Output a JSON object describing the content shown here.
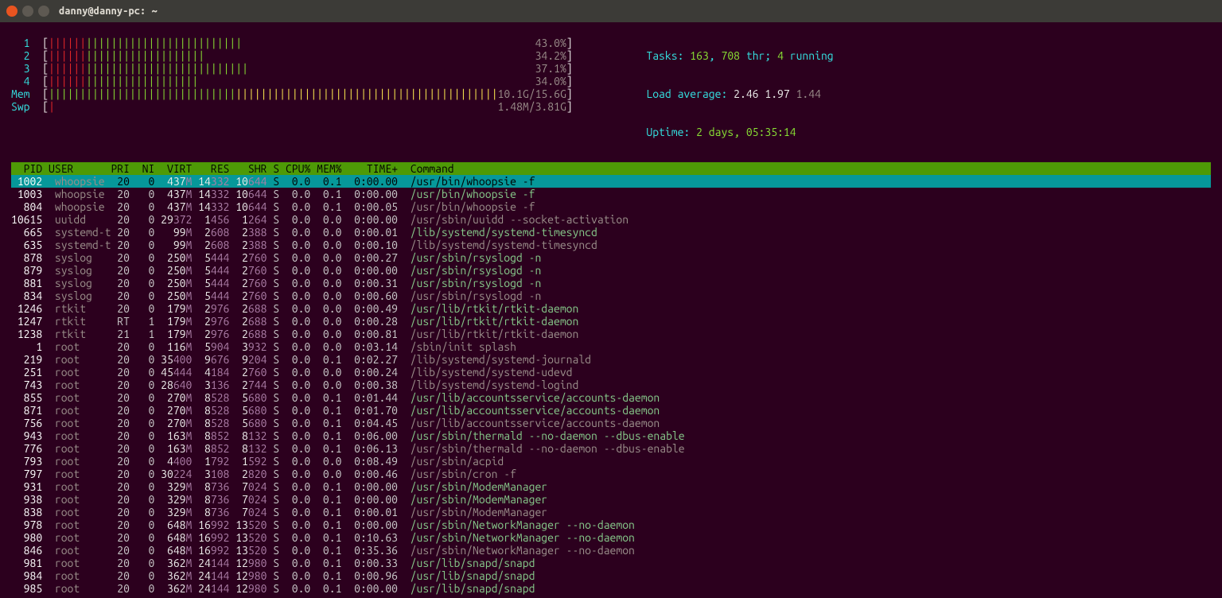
{
  "window": {
    "title": "danny@danny-pc: ~"
  },
  "meters": {
    "cpu": [
      {
        "label": "1",
        "bars": "|||||||||||||||||||||||||||||||",
        "percent": "43.0%"
      },
      {
        "label": "2",
        "bars": "|||||||||||||||||||||||||",
        "percent": "34.2%"
      },
      {
        "label": "3",
        "bars": "||||||||||||||||||||||||||||||||",
        "percent": "37.1%"
      },
      {
        "label": "4",
        "bars": "||||||||||||||||||||||||",
        "percent": "34.0%"
      }
    ],
    "mem": {
      "label": "Mem",
      "used": "10.1G",
      "total": "15.6G"
    },
    "swp": {
      "label": "Swp",
      "used": "1.48M",
      "total": "3.81G"
    }
  },
  "summary": {
    "tasks_label": "Tasks: ",
    "tasks": "163",
    "thr": "708",
    "thr_label": " thr; ",
    "running": "4",
    "running_label": " running",
    "load_label": "Load average: ",
    "load1": "2.46",
    "load2": "1.97",
    "load3": "1.44",
    "uptime_label": "Uptime: ",
    "uptime": "2 days, 05:35:14"
  },
  "columns": [
    "PID",
    "USER",
    "PRI",
    "NI",
    "VIRT",
    "RES",
    "SHR",
    "S",
    "CPU%",
    "MEM%",
    "TIME+",
    "Command"
  ],
  "processes": [
    {
      "pid": "1002",
      "user": "whoopsie",
      "pri": "20",
      "ni": "0",
      "virt": "437M",
      "res": "14332",
      "shr": "10644",
      "s": "S",
      "cpu": "0.0",
      "mem": "0.1",
      "time": "0:00.00",
      "cmd": "/usr/bin/whoopsie -f",
      "sel": true,
      "hl": true
    },
    {
      "pid": "1003",
      "user": "whoopsie",
      "pri": "20",
      "ni": "0",
      "virt": "437M",
      "res": "14332",
      "shr": "10644",
      "s": "S",
      "cpu": "0.0",
      "mem": "0.1",
      "time": "0:00.00",
      "cmd": "/usr/bin/whoopsie -f",
      "hl": true
    },
    {
      "pid": "804",
      "user": "whoopsie",
      "pri": "20",
      "ni": "0",
      "virt": "437M",
      "res": "14332",
      "shr": "10644",
      "s": "S",
      "cpu": "0.0",
      "mem": "0.1",
      "time": "0:00.05",
      "cmd": "/usr/bin/whoopsie -f"
    },
    {
      "pid": "10615",
      "user": "uuidd",
      "pri": "20",
      "ni": "0",
      "virt": "29372",
      "res": "1456",
      "shr": "1264",
      "s": "S",
      "cpu": "0.0",
      "mem": "0.0",
      "time": "0:00.00",
      "cmd": "/usr/sbin/uuidd --socket-activation"
    },
    {
      "pid": "665",
      "user": "systemd-t",
      "pri": "20",
      "ni": "0",
      "virt": "99M",
      "res": "2608",
      "shr": "2388",
      "s": "S",
      "cpu": "0.0",
      "mem": "0.0",
      "time": "0:00.01",
      "cmd": "/lib/systemd/systemd-timesyncd",
      "hl": true
    },
    {
      "pid": "635",
      "user": "systemd-t",
      "pri": "20",
      "ni": "0",
      "virt": "99M",
      "res": "2608",
      "shr": "2388",
      "s": "S",
      "cpu": "0.0",
      "mem": "0.0",
      "time": "0:00.10",
      "cmd": "/lib/systemd/systemd-timesyncd"
    },
    {
      "pid": "878",
      "user": "syslog",
      "pri": "20",
      "ni": "0",
      "virt": "250M",
      "res": "5444",
      "shr": "2760",
      "s": "S",
      "cpu": "0.0",
      "mem": "0.0",
      "time": "0:00.27",
      "cmd": "/usr/sbin/rsyslogd -n",
      "hl": true
    },
    {
      "pid": "879",
      "user": "syslog",
      "pri": "20",
      "ni": "0",
      "virt": "250M",
      "res": "5444",
      "shr": "2760",
      "s": "S",
      "cpu": "0.0",
      "mem": "0.0",
      "time": "0:00.00",
      "cmd": "/usr/sbin/rsyslogd -n",
      "hl": true
    },
    {
      "pid": "881",
      "user": "syslog",
      "pri": "20",
      "ni": "0",
      "virt": "250M",
      "res": "5444",
      "shr": "2760",
      "s": "S",
      "cpu": "0.0",
      "mem": "0.0",
      "time": "0:00.31",
      "cmd": "/usr/sbin/rsyslogd -n",
      "hl": true
    },
    {
      "pid": "834",
      "user": "syslog",
      "pri": "20",
      "ni": "0",
      "virt": "250M",
      "res": "5444",
      "shr": "2760",
      "s": "S",
      "cpu": "0.0",
      "mem": "0.0",
      "time": "0:00.60",
      "cmd": "/usr/sbin/rsyslogd -n"
    },
    {
      "pid": "1246",
      "user": "rtkit",
      "pri": "20",
      "ni": "0",
      "virt": "179M",
      "res": "2976",
      "shr": "2688",
      "s": "S",
      "cpu": "0.0",
      "mem": "0.0",
      "time": "0:00.49",
      "cmd": "/usr/lib/rtkit/rtkit-daemon",
      "hl": true
    },
    {
      "pid": "1247",
      "user": "rtkit",
      "pri": "RT",
      "ni": "1",
      "virt": "179M",
      "res": "2976",
      "shr": "2688",
      "s": "S",
      "cpu": "0.0",
      "mem": "0.0",
      "time": "0:00.28",
      "cmd": "/usr/lib/rtkit/rtkit-daemon",
      "hl": true
    },
    {
      "pid": "1238",
      "user": "rtkit",
      "pri": "21",
      "ni": "1",
      "virt": "179M",
      "res": "2976",
      "shr": "2688",
      "s": "S",
      "cpu": "0.0",
      "mem": "0.0",
      "time": "0:00.81",
      "cmd": "/usr/lib/rtkit/rtkit-daemon"
    },
    {
      "pid": "1",
      "user": "root",
      "pri": "20",
      "ni": "0",
      "virt": "116M",
      "res": "5904",
      "shr": "3932",
      "s": "S",
      "cpu": "0.0",
      "mem": "0.0",
      "time": "0:03.14",
      "cmd": "/sbin/init splash"
    },
    {
      "pid": "219",
      "user": "root",
      "pri": "20",
      "ni": "0",
      "virt": "35400",
      "res": "9676",
      "shr": "9204",
      "s": "S",
      "cpu": "0.0",
      "mem": "0.1",
      "time": "0:02.27",
      "cmd": "/lib/systemd/systemd-journald"
    },
    {
      "pid": "251",
      "user": "root",
      "pri": "20",
      "ni": "0",
      "virt": "45444",
      "res": "4184",
      "shr": "2760",
      "s": "S",
      "cpu": "0.0",
      "mem": "0.0",
      "time": "0:00.24",
      "cmd": "/lib/systemd/systemd-udevd"
    },
    {
      "pid": "743",
      "user": "root",
      "pri": "20",
      "ni": "0",
      "virt": "28640",
      "res": "3136",
      "shr": "2744",
      "s": "S",
      "cpu": "0.0",
      "mem": "0.0",
      "time": "0:00.38",
      "cmd": "/lib/systemd/systemd-logind"
    },
    {
      "pid": "855",
      "user": "root",
      "pri": "20",
      "ni": "0",
      "virt": "270M",
      "res": "8528",
      "shr": "5680",
      "s": "S",
      "cpu": "0.0",
      "mem": "0.1",
      "time": "0:01.44",
      "cmd": "/usr/lib/accountsservice/accounts-daemon",
      "hl": true
    },
    {
      "pid": "871",
      "user": "root",
      "pri": "20",
      "ni": "0",
      "virt": "270M",
      "res": "8528",
      "shr": "5680",
      "s": "S",
      "cpu": "0.0",
      "mem": "0.1",
      "time": "0:01.70",
      "cmd": "/usr/lib/accountsservice/accounts-daemon",
      "hl": true
    },
    {
      "pid": "756",
      "user": "root",
      "pri": "20",
      "ni": "0",
      "virt": "270M",
      "res": "8528",
      "shr": "5680",
      "s": "S",
      "cpu": "0.0",
      "mem": "0.1",
      "time": "0:04.45",
      "cmd": "/usr/lib/accountsservice/accounts-daemon"
    },
    {
      "pid": "943",
      "user": "root",
      "pri": "20",
      "ni": "0",
      "virt": "163M",
      "res": "8852",
      "shr": "8132",
      "s": "S",
      "cpu": "0.0",
      "mem": "0.1",
      "time": "0:06.00",
      "cmd": "/usr/sbin/thermald --no-daemon --dbus-enable",
      "hl": true
    },
    {
      "pid": "776",
      "user": "root",
      "pri": "20",
      "ni": "0",
      "virt": "163M",
      "res": "8852",
      "shr": "8132",
      "s": "S",
      "cpu": "0.0",
      "mem": "0.1",
      "time": "0:06.13",
      "cmd": "/usr/sbin/thermald --no-daemon --dbus-enable"
    },
    {
      "pid": "793",
      "user": "root",
      "pri": "20",
      "ni": "0",
      "virt": "4400",
      "res": "1792",
      "shr": "1592",
      "s": "S",
      "cpu": "0.0",
      "mem": "0.0",
      "time": "0:08.49",
      "cmd": "/usr/sbin/acpid"
    },
    {
      "pid": "797",
      "user": "root",
      "pri": "20",
      "ni": "0",
      "virt": "30224",
      "res": "3108",
      "shr": "2820",
      "s": "S",
      "cpu": "0.0",
      "mem": "0.0",
      "time": "0:00.46",
      "cmd": "/usr/sbin/cron -f"
    },
    {
      "pid": "931",
      "user": "root",
      "pri": "20",
      "ni": "0",
      "virt": "329M",
      "res": "8736",
      "shr": "7024",
      "s": "S",
      "cpu": "0.0",
      "mem": "0.1",
      "time": "0:00.00",
      "cmd": "/usr/sbin/ModemManager",
      "hl": true
    },
    {
      "pid": "938",
      "user": "root",
      "pri": "20",
      "ni": "0",
      "virt": "329M",
      "res": "8736",
      "shr": "7024",
      "s": "S",
      "cpu": "0.0",
      "mem": "0.1",
      "time": "0:00.00",
      "cmd": "/usr/sbin/ModemManager",
      "hl": true
    },
    {
      "pid": "838",
      "user": "root",
      "pri": "20",
      "ni": "0",
      "virt": "329M",
      "res": "8736",
      "shr": "7024",
      "s": "S",
      "cpu": "0.0",
      "mem": "0.1",
      "time": "0:00.01",
      "cmd": "/usr/sbin/ModemManager"
    },
    {
      "pid": "978",
      "user": "root",
      "pri": "20",
      "ni": "0",
      "virt": "648M",
      "res": "16992",
      "shr": "13520",
      "s": "S",
      "cpu": "0.0",
      "mem": "0.1",
      "time": "0:00.00",
      "cmd": "/usr/sbin/NetworkManager --no-daemon",
      "hl": true
    },
    {
      "pid": "980",
      "user": "root",
      "pri": "20",
      "ni": "0",
      "virt": "648M",
      "res": "16992",
      "shr": "13520",
      "s": "S",
      "cpu": "0.0",
      "mem": "0.1",
      "time": "0:10.63",
      "cmd": "/usr/sbin/NetworkManager --no-daemon",
      "hl": true
    },
    {
      "pid": "846",
      "user": "root",
      "pri": "20",
      "ni": "0",
      "virt": "648M",
      "res": "16992",
      "shr": "13520",
      "s": "S",
      "cpu": "0.0",
      "mem": "0.1",
      "time": "0:35.36",
      "cmd": "/usr/sbin/NetworkManager --no-daemon"
    },
    {
      "pid": "981",
      "user": "root",
      "pri": "20",
      "ni": "0",
      "virt": "362M",
      "res": "24144",
      "shr": "12980",
      "s": "S",
      "cpu": "0.0",
      "mem": "0.1",
      "time": "0:00.33",
      "cmd": "/usr/lib/snapd/snapd",
      "hl": true
    },
    {
      "pid": "984",
      "user": "root",
      "pri": "20",
      "ni": "0",
      "virt": "362M",
      "res": "24144",
      "shr": "12980",
      "s": "S",
      "cpu": "0.0",
      "mem": "0.1",
      "time": "0:00.96",
      "cmd": "/usr/lib/snapd/snapd",
      "hl": true
    },
    {
      "pid": "985",
      "user": "root",
      "pri": "20",
      "ni": "0",
      "virt": "362M",
      "res": "24144",
      "shr": "12980",
      "s": "S",
      "cpu": "0.0",
      "mem": "0.1",
      "time": "0:00.00",
      "cmd": "/usr/lib/snapd/snapd",
      "hl": true
    }
  ]
}
